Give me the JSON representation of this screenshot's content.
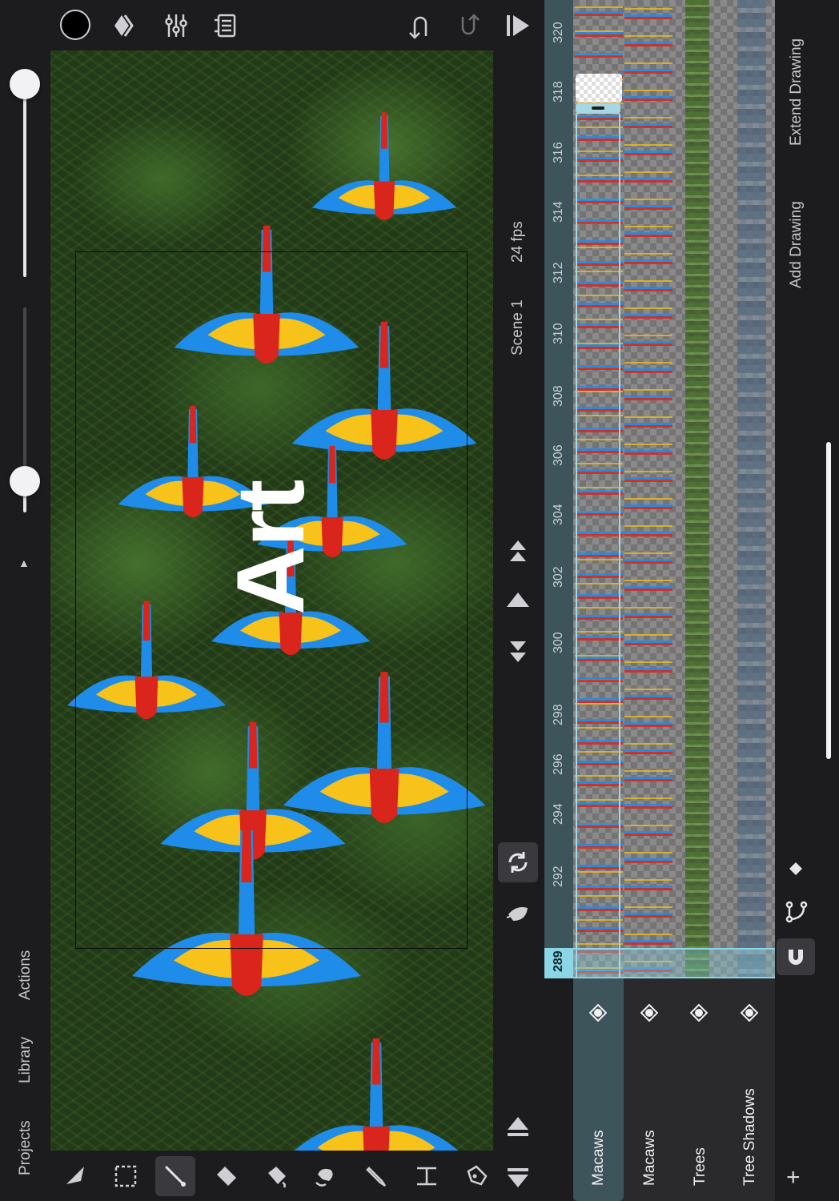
{
  "top_toolbar": {
    "icons": [
      "color-swatch",
      "layers-diamond-icon",
      "sliders-icon",
      "stamp-icon",
      "undo-icon",
      "redo-icon",
      "play-icon"
    ],
    "current_color": "#000000"
  },
  "left_nav": {
    "projects": "Projects",
    "library": "Library",
    "actions": "Actions"
  },
  "brush_sliders": {
    "size_level": 1.0,
    "opacity_level": 0.12
  },
  "scene": {
    "name": "Scene 1",
    "fps": "24 fps"
  },
  "canvas": {
    "overlay_text": "Art"
  },
  "timeline": {
    "current_frame": "289",
    "ticks": [
      "292",
      "294",
      "296",
      "298",
      "300",
      "302",
      "304",
      "306",
      "308",
      "310",
      "312",
      "314",
      "316",
      "318",
      "320"
    ],
    "layers": [
      {
        "name": "Macaws",
        "active": true
      },
      {
        "name": "Macaws",
        "active": false
      },
      {
        "name": "Trees",
        "active": false
      },
      {
        "name": "Tree Shadows",
        "active": false
      }
    ],
    "actions": {
      "add_drawing": "Add Drawing",
      "extend_drawing": "Extend Drawing"
    }
  },
  "colors": {
    "accent": "#8ad6e6",
    "macaw_red": "#d9251c",
    "macaw_blue": "#1e8ce8",
    "macaw_yellow": "#f7c21a"
  },
  "tools": [
    "select-arrow-icon",
    "marquee-select-icon",
    "brush-icon",
    "eraser-icon",
    "fill-icon",
    "lasso-fill-icon",
    "eyedropper-icon",
    "ruler-icon",
    "pen-icon"
  ]
}
